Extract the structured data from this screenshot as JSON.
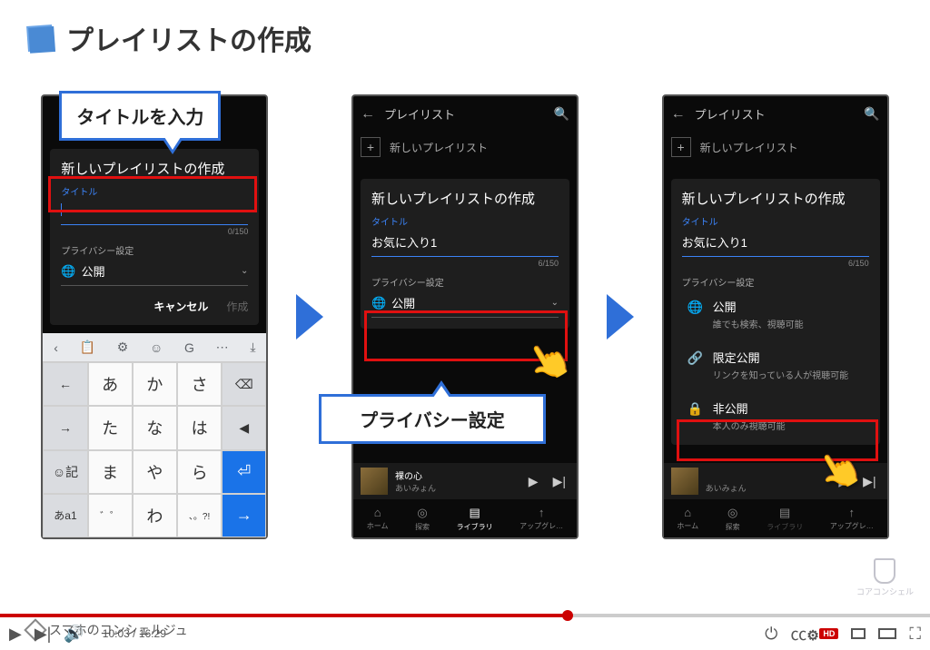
{
  "slide": {
    "title": "プレイリストの作成"
  },
  "callouts": {
    "title_input": "タイトルを入力",
    "privacy": "プライバシー設定"
  },
  "phone_header": {
    "title": "プレイリスト",
    "new_playlist": "新しいプレイリスト"
  },
  "modal": {
    "heading": "新しいプレイリストの作成",
    "title_label": "タイトル",
    "title_value_filled": "お気に入り1",
    "counter_empty": "0/150",
    "counter_filled": "6/150",
    "privacy_label": "プライバシー設定",
    "privacy_value": "公開",
    "cancel": "キャンセル",
    "create": "作成"
  },
  "privacy_options": [
    {
      "icon": "globe",
      "title": "公開",
      "desc": "誰でも検索、視聴可能"
    },
    {
      "icon": "link",
      "title": "限定公開",
      "desc": "リンクを知っている人が視聴可能"
    },
    {
      "icon": "lock",
      "title": "非公開",
      "desc": "本人のみ視聴可能"
    }
  ],
  "keyboard": {
    "toolbar": [
      "‹",
      "📋",
      "⚙",
      "☺",
      "G",
      "⋯",
      "⤓"
    ],
    "rows": [
      [
        "←",
        "あ",
        "か",
        "さ",
        "⌫"
      ],
      [
        "→",
        "た",
        "な",
        "は",
        "◀"
      ],
      [
        "☺記",
        "ま",
        "や",
        "ら",
        "⏎"
      ],
      [
        "あa1",
        "゛゜",
        "わ",
        "、。?!",
        "→"
      ]
    ]
  },
  "mini_player": {
    "song": "裸の心",
    "artist": "あいみょん"
  },
  "nav": [
    {
      "icon": "⌂",
      "label": "ホーム"
    },
    {
      "icon": "◎",
      "label": "探索"
    },
    {
      "icon": "▤",
      "label": "ライブラリ"
    },
    {
      "icon": "↑",
      "label": "アップグレ…"
    }
  ],
  "watermark": "スマホのコンシェルジュ",
  "corner_brand": "コアコンシェル",
  "video": {
    "current": "10:03",
    "duration": "16:29",
    "progress_pct": 61,
    "hd": "HD"
  }
}
